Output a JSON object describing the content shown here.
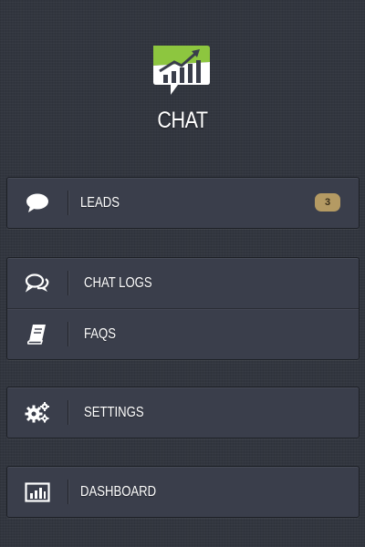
{
  "header": {
    "logo_icon": "chat-growth-chart-logo",
    "title": "CHAT"
  },
  "menu": {
    "leads": {
      "label": "LEADS",
      "icon": "speech-bubble-icon",
      "badge": "3"
    },
    "chat_logs": {
      "label": "CHAT LOGS",
      "icon": "conversation-icon"
    },
    "faqs": {
      "label": "FAQS",
      "icon": "book-icon"
    },
    "settings": {
      "label": "SETTINGS",
      "icon": "gears-icon"
    },
    "dashboard": {
      "label": "DASHBOARD",
      "icon": "bar-chart-icon"
    }
  },
  "colors": {
    "background": "#32363f",
    "panel": "#3a3e4b",
    "badge": "#b49a63",
    "logo_green": "#8dc63f"
  }
}
